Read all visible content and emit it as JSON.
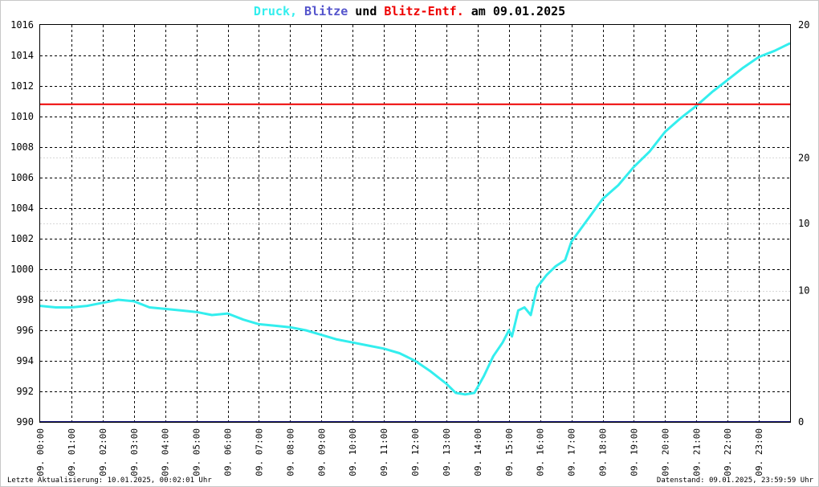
{
  "title": {
    "part1": "Druck,",
    "part2": "Blitze",
    "part3": "und",
    "part4": "Blitz-Entf.",
    "part5": "am 09.01.2025"
  },
  "colors": {
    "pressure": "#33eeee",
    "strikes": "#5555cc",
    "distance": "#ee0000",
    "baseline": "#1a1a80",
    "grid": "#000000",
    "right_axis_ticks": "#cc0000"
  },
  "footer": {
    "left": "Letzte Aktualisierung: 10.01.2025, 00:02:01 Uhr",
    "right": "Datenstand: 09.01.2025, 23:59:59 Uhr"
  },
  "chart_data": {
    "type": "line",
    "title": "Druck, Blitze und Blitz-Entf. am 09.01.2025",
    "x_ticks": [
      "09. 00:00",
      "09. 01:00",
      "09. 02:00",
      "09. 03:00",
      "09. 04:00",
      "09. 05:00",
      "09. 06:00",
      "09. 07:00",
      "09. 08:00",
      "09. 09:00",
      "09. 10:00",
      "09. 11:00",
      "09. 12:00",
      "09. 13:00",
      "09. 14:00",
      "09. 15:00",
      "09. 16:00",
      "09. 17:00",
      "09. 18:00",
      "09. 19:00",
      "09. 20:00",
      "09. 21:00",
      "09. 22:00",
      "09. 23:00"
    ],
    "x_unit": "hours",
    "xlim": [
      0,
      24
    ],
    "y_left": {
      "ylim": [
        990,
        1016
      ],
      "ticks": [
        "990",
        "992",
        "994",
        "996",
        "998",
        "1000",
        "1002",
        "1004",
        "1006",
        "1008",
        "1010",
        "1012",
        "1014",
        "1016"
      ]
    },
    "y_right": {
      "ticks": [
        "0",
        "10",
        "10",
        "20",
        "20"
      ],
      "tick_pos_left_units": [
        990,
        998.6,
        1003,
        1007.3,
        1016
      ]
    },
    "grid": true,
    "series": [
      {
        "name": "Druck",
        "x": [
          0,
          0.5,
          1,
          1.5,
          2,
          2.5,
          3,
          3.5,
          4,
          4.5,
          5,
          5.5,
          6,
          6.5,
          7,
          7.5,
          8,
          8.5,
          9,
          9.5,
          10,
          10.5,
          11,
          11.5,
          12,
          12.5,
          13,
          13.3,
          13.6,
          13.9,
          14.2,
          14.5,
          14.8,
          15,
          15.1,
          15.3,
          15.5,
          15.7,
          15.9,
          16.2,
          16.5,
          16.8,
          17,
          17.5,
          18,
          18.5,
          19,
          19.5,
          20,
          20.5,
          21,
          21.5,
          22,
          22.5,
          23,
          23.5,
          24
        ],
        "y": [
          997.6,
          997.5,
          997.5,
          997.6,
          997.8,
          998.0,
          997.9,
          997.5,
          997.4,
          997.3,
          997.2,
          997.0,
          997.1,
          996.7,
          996.4,
          996.3,
          996.2,
          996.0,
          995.7,
          995.4,
          995.2,
          995.0,
          994.8,
          994.5,
          994.0,
          993.3,
          992.5,
          991.9,
          991.8,
          991.9,
          993.0,
          994.3,
          995.2,
          996.0,
          995.6,
          997.3,
          997.5,
          997.0,
          998.8,
          999.6,
          1000.2,
          1000.6,
          1001.8,
          1003.2,
          1004.6,
          1005.5,
          1006.7,
          1007.7,
          1009.0,
          1009.9,
          1010.7,
          1011.6,
          1012.4,
          1013.2,
          1013.9,
          1014.3,
          1014.8
        ]
      },
      {
        "name": "Blitz-Entf.",
        "x": [
          0,
          24
        ],
        "y": [
          1010.8,
          1010.8
        ]
      },
      {
        "name": "Blitze",
        "x": [
          0,
          24
        ],
        "y": [
          990,
          990
        ]
      }
    ]
  }
}
